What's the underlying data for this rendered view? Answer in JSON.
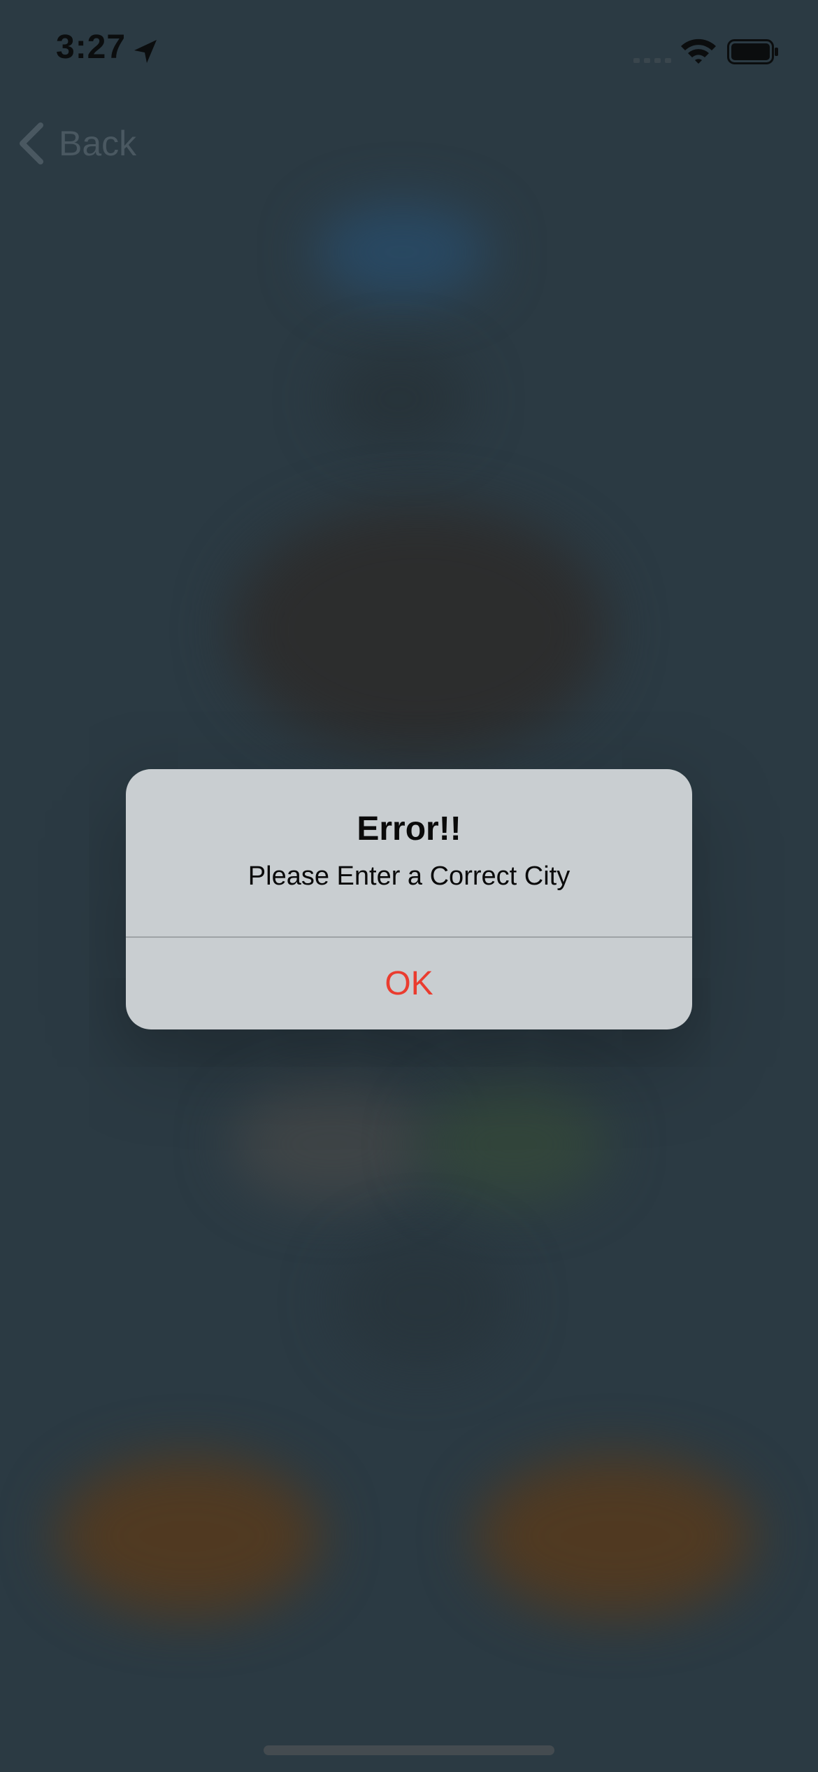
{
  "status_bar": {
    "time": "3:27",
    "icons": [
      "location-arrow-icon",
      "cellular-signal-icon",
      "wifi-icon",
      "battery-icon"
    ]
  },
  "nav": {
    "back_label": "Back",
    "back_icon": "chevron-left-icon"
  },
  "alert": {
    "title": "Error!!",
    "message": "Please Enter a Correct City",
    "ok_label": "OK"
  },
  "colors": {
    "background": "#2b3a43",
    "alert_background": "#c9ced1",
    "alert_action": "#ea3c2f",
    "status_bar_text": "#0b0d0e",
    "back_button_dimmed": "#4a5861"
  }
}
